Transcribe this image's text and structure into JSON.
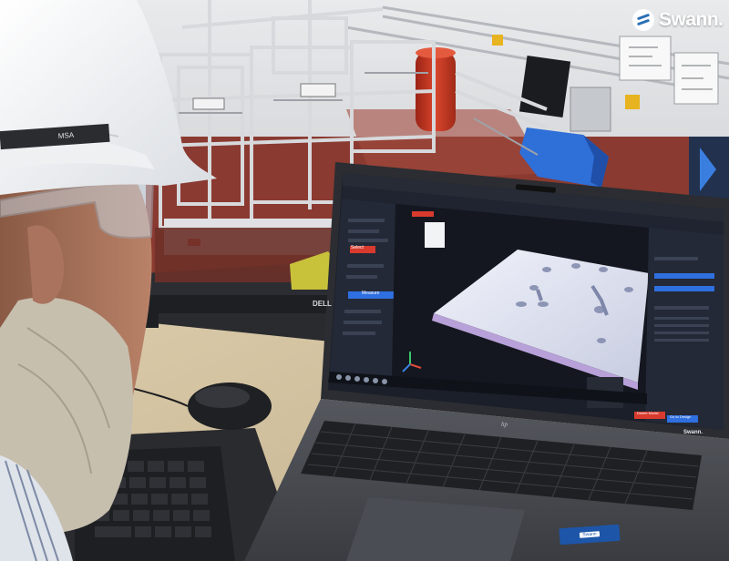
{
  "brand": {
    "logo_text": "Swann.",
    "monitor_brand": "DELL",
    "laptop_brand": "hp",
    "laptop_screen_brand": "Swann."
  },
  "laptop_ui": {
    "left_buttons": [
      "Select",
      "Measure"
    ],
    "right_buttons": [
      "Delete Model",
      "Go to Design"
    ]
  },
  "sticker_text": "Swann",
  "colors": {
    "accent_blue": "#2f6fe0",
    "accent_red": "#d83b2e",
    "panel_dark": "#1b1f29",
    "viewport": "#14171f",
    "tank_red": "#c8321e",
    "machine_blue": "#2f6fd8"
  }
}
